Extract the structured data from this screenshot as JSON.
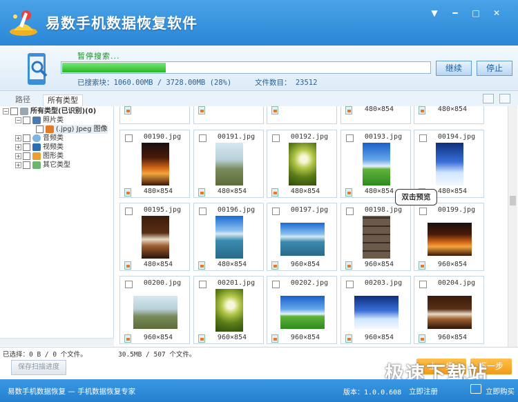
{
  "window": {
    "title": "易数手机数据恢复软件",
    "controls": [
      "menu-icon",
      "minimize-icon",
      "maximize-icon",
      "close-icon"
    ]
  },
  "progress": {
    "status": "暂停搜索...",
    "percent": 28,
    "searched_label": "已搜索块：1060.00MB / 3728.00MB (28%)",
    "files_label": "文件数目：  23512",
    "continue_btn": "继续",
    "stop_btn": "停止"
  },
  "tabs": [
    "路径",
    "所有类型"
  ],
  "tree": [
    {
      "label": "所有类型(已识别)(0)",
      "bold": true
    },
    {
      "label": "照片类"
    },
    {
      "label": "(.jpg) Jpeg 图像"
    },
    {
      "label": "音频类"
    },
    {
      "label": "视频类"
    },
    {
      "label": "图形类"
    },
    {
      "label": "其它类型"
    }
  ],
  "files": [
    {
      "name": "",
      "dims": "",
      "scene": ""
    },
    {
      "name": "",
      "dims": "",
      "scene": ""
    },
    {
      "name": "",
      "dims": "",
      "scene": ""
    },
    {
      "name": "",
      "dims": "480×854",
      "scene": "grass"
    },
    {
      "name": "",
      "dims": "480×854",
      "scene": "coffee"
    },
    {
      "name": "00190.jpg",
      "dims": "480×854",
      "scene": "city"
    },
    {
      "name": "00191.jpg",
      "dims": "480×854",
      "scene": "bench"
    },
    {
      "name": "00192.jpg",
      "dims": "480×854",
      "scene": "dandelion"
    },
    {
      "name": "00193.jpg",
      "dims": "480×854",
      "scene": "field"
    },
    {
      "name": "00194.jpg",
      "dims": "480×854",
      "scene": "winter"
    },
    {
      "name": "00195.jpg",
      "dims": "480×854",
      "scene": "coffee"
    },
    {
      "name": "00196.jpg",
      "dims": "480×854",
      "scene": "lake"
    },
    {
      "name": "00197.jpg",
      "dims": "960×854",
      "scene": "lake"
    },
    {
      "name": "00198.jpg",
      "dims": "960×854",
      "scene": "stone"
    },
    {
      "name": "00199.jpg",
      "dims": "960×854",
      "scene": "city"
    },
    {
      "name": "00200.jpg",
      "dims": "960×854",
      "scene": "bench"
    },
    {
      "name": "00201.jpg",
      "dims": "960×854",
      "scene": "dandelion"
    },
    {
      "name": "00202.jpg",
      "dims": "960×854",
      "scene": "field"
    },
    {
      "name": "00203.jpg",
      "dims": "960×854",
      "scene": "winter"
    },
    {
      "name": "00204.jpg",
      "dims": "960×854",
      "scene": "coffee"
    }
  ],
  "tooltip": "双击预览",
  "footer": {
    "selected": "已选择：0 B / 0 个文件。",
    "total": "30.5MB / 507 个文件。",
    "save_progress": "保存扫描进度",
    "prev_btn": "上一步",
    "next_btn": "下一步"
  },
  "statusbar": {
    "app": "易数手机数据恢复 — 手机数据恢复专家",
    "version": "版本：1.0.0.608",
    "register": "立即注册",
    "buy": "立即购买"
  },
  "watermark": "极速下载站"
}
